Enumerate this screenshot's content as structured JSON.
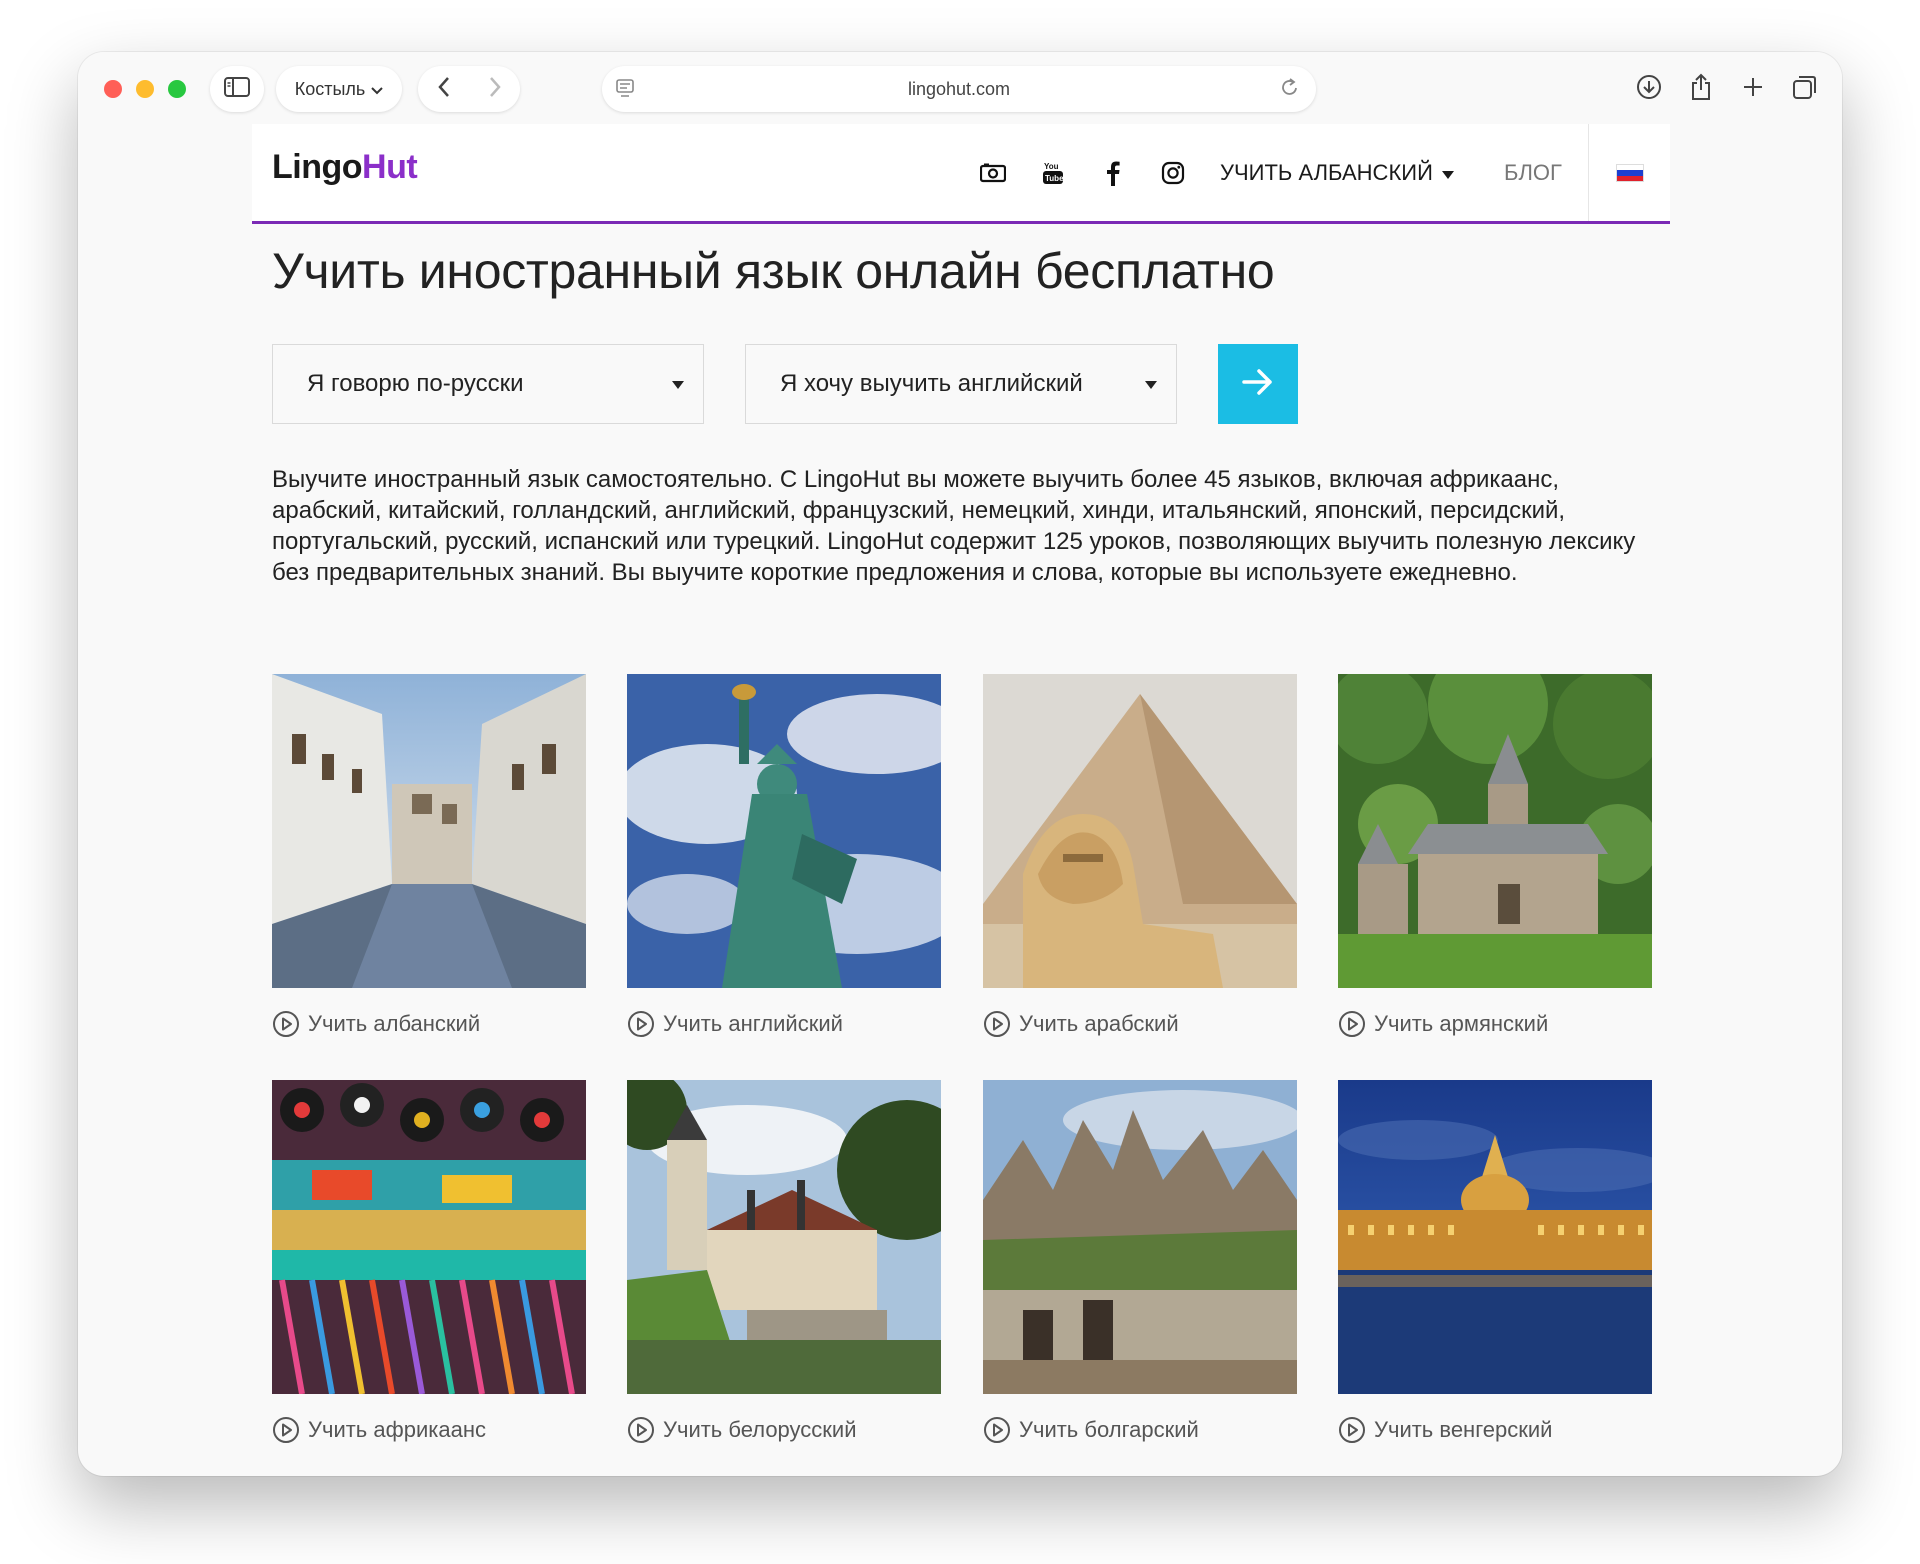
{
  "browser": {
    "profile_label": "Костыль",
    "address": "lingohut.com"
  },
  "header": {
    "logo_part1": "Lingo",
    "logo_part2": "Hut",
    "learn_menu": "УЧИТЬ АЛБАНСКИЙ",
    "blog": "БЛОГ",
    "social_icons": [
      "camera-icon",
      "youtube-icon",
      "facebook-icon",
      "instagram-icon"
    ]
  },
  "main": {
    "title": "Учить иностранный язык онлайн бесплатно",
    "speak_select": "Я говорю по-русски",
    "learn_select": "Я хочу выучить английский",
    "intro": "Выучите иностранный язык самостоятельно. С LingoHut вы можете выучить более 45 языков, включая африкаанс, арабский, китайский, голландский, английский, французский, немецкий, хинди, итальянский, японский, персидский, португальский, русский, испанский или турецкий. LingoHut содержит 125 уроков, позволяющих выучить полезную лексику без предварительных знаний. Вы выучите короткие предложения и слова, которые вы используете ежедневно."
  },
  "languages": [
    {
      "label": "Учить албанский"
    },
    {
      "label": "Учить английский"
    },
    {
      "label": "Учить арабский"
    },
    {
      "label": "Учить армянский"
    },
    {
      "label": "Учить африкаанс"
    },
    {
      "label": "Учить белорусский"
    },
    {
      "label": "Учить болгарский"
    },
    {
      "label": "Учить венгерский"
    }
  ],
  "colors": {
    "accent_purple": "#7b2ab5",
    "button_blue": "#1bbde4",
    "background": "#f9f9f9"
  }
}
